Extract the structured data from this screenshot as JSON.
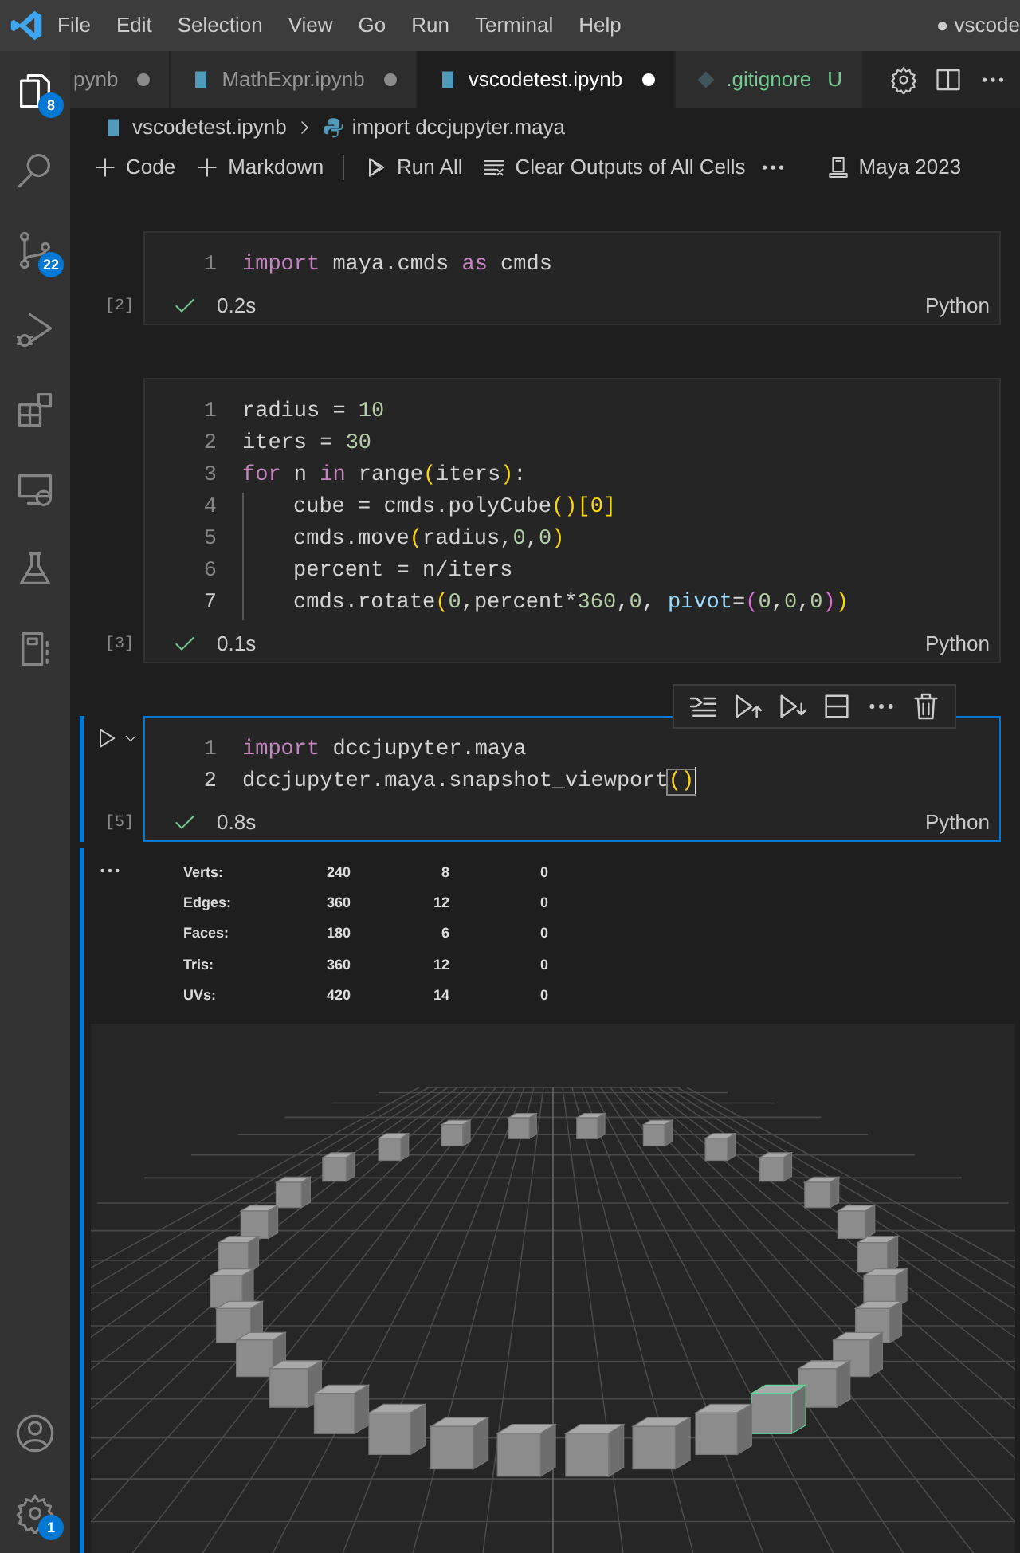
{
  "title_bar": {
    "menu": [
      "File",
      "Edit",
      "Selection",
      "View",
      "Go",
      "Run",
      "Terminal",
      "Help"
    ],
    "title": "● vscode"
  },
  "activity_bar": {
    "items": [
      {
        "kind": "files",
        "selected": true,
        "badge": "8"
      },
      {
        "kind": "search",
        "selected": false
      },
      {
        "kind": "source-control",
        "selected": false,
        "badge": "22"
      },
      {
        "kind": "debug",
        "selected": false
      },
      {
        "kind": "extensions",
        "selected": false
      },
      {
        "kind": "remote",
        "selected": false
      },
      {
        "kind": "testing",
        "selected": false
      },
      {
        "kind": "notebook",
        "selected": false
      }
    ],
    "bottom": [
      {
        "kind": "account"
      },
      {
        "kind": "settings",
        "badge": "1"
      }
    ]
  },
  "tabs": [
    {
      "label": "pynb",
      "selected": false,
      "modified": true,
      "untracked": false
    },
    {
      "label": "MathExpr.ipynb",
      "kind": "notebook",
      "selected": false,
      "modified": true,
      "untracked": false
    },
    {
      "label": "vscodetest.ipynb",
      "kind": "notebook",
      "selected": true,
      "modified": true,
      "untracked": false
    },
    {
      "label": ".gitignore",
      "kind": "git",
      "selected": false,
      "modified": false,
      "untracked": true,
      "status": "U"
    }
  ],
  "breadcrumb": [
    "vscodetest.ipynb",
    "import dccjupyter.maya"
  ],
  "toolbar": {
    "buttons": [
      {
        "kind": "plus",
        "label": "Code"
      },
      {
        "kind": "plus",
        "label": "Markdown"
      },
      {
        "kind": "run-all",
        "label": "Run All"
      },
      {
        "kind": "clear",
        "label": "Clear Outputs of All Cells"
      }
    ],
    "kernel": "Maya 2023"
  },
  "cells": [
    {
      "exec": "[2]",
      "time": "0.2s",
      "language": "Python",
      "focused": false,
      "lines": [
        {
          "n": "1",
          "current": false,
          "indented": false,
          "tokens": [
            {
              "kind": "kw",
              "text": "import"
            },
            {
              "kind": "id",
              "text": " maya.cmds "
            },
            {
              "kind": "kw",
              "text": "as"
            },
            {
              "kind": "id",
              "text": " cmds"
            }
          ]
        }
      ]
    },
    {
      "exec": "[3]",
      "time": "0.1s",
      "language": "Python",
      "focused": false,
      "lines": [
        {
          "n": "1",
          "current": false,
          "indented": false,
          "tokens": [
            {
              "kind": "id",
              "text": "radius = "
            },
            {
              "kind": "num",
              "text": "10"
            }
          ]
        },
        {
          "n": "2",
          "current": false,
          "indented": false,
          "tokens": [
            {
              "kind": "id",
              "text": "iters = "
            },
            {
              "kind": "num",
              "text": "30"
            }
          ]
        },
        {
          "n": "3",
          "current": false,
          "indented": false,
          "tokens": [
            {
              "kind": "kw",
              "text": "for"
            },
            {
              "kind": "id",
              "text": " n "
            },
            {
              "kind": "kw",
              "text": "in"
            },
            {
              "kind": "id",
              "text": " range"
            },
            {
              "kind": "br",
              "text": "("
            },
            {
              "kind": "id",
              "text": "iters"
            },
            {
              "kind": "br",
              "text": ")"
            },
            {
              "kind": "id",
              "text": ":"
            }
          ]
        },
        {
          "n": "4",
          "current": false,
          "indented": true,
          "tokens": [
            {
              "kind": "id",
              "text": "cube = cmds.polyCube"
            },
            {
              "kind": "br",
              "text": "()[0]"
            }
          ]
        },
        {
          "n": "5",
          "current": false,
          "indented": true,
          "tokens": [
            {
              "kind": "id",
              "text": "cmds.move"
            },
            {
              "kind": "br",
              "text": "("
            },
            {
              "kind": "id",
              "text": "radius,"
            },
            {
              "kind": "num",
              "text": "0"
            },
            {
              "kind": "id",
              "text": ","
            },
            {
              "kind": "num",
              "text": "0"
            },
            {
              "kind": "br",
              "text": ")"
            }
          ]
        },
        {
          "n": "6",
          "current": false,
          "indented": true,
          "tokens": [
            {
              "kind": "id",
              "text": "percent = n/iters"
            }
          ]
        },
        {
          "n": "7",
          "current": true,
          "indented": true,
          "tokens": [
            {
              "kind": "id",
              "text": "cmds.rotate"
            },
            {
              "kind": "br",
              "text": "("
            },
            {
              "kind": "num",
              "text": "0"
            },
            {
              "kind": "id",
              "text": ",percent*"
            },
            {
              "kind": "num",
              "text": "360"
            },
            {
              "kind": "id",
              "text": ","
            },
            {
              "kind": "num",
              "text": "0"
            },
            {
              "kind": "id",
              "text": ", "
            },
            {
              "kind": "param",
              "text": "pivot"
            },
            {
              "kind": "id",
              "text": "="
            },
            {
              "kind": "br2",
              "text": "("
            },
            {
              "kind": "num",
              "text": "0"
            },
            {
              "kind": "id",
              "text": ","
            },
            {
              "kind": "num",
              "text": "0"
            },
            {
              "kind": "id",
              "text": ","
            },
            {
              "kind": "num",
              "text": "0"
            },
            {
              "kind": "br2",
              "text": ")"
            },
            {
              "kind": "br",
              "text": ")"
            }
          ]
        }
      ]
    },
    {
      "exec": "[5]",
      "time": "0.8s",
      "language": "Python",
      "focused": true,
      "lines": [
        {
          "n": "1",
          "current": false,
          "indented": false,
          "tokens": [
            {
              "kind": "kw",
              "text": "import"
            },
            {
              "kind": "id",
              "text": " dccjupyter.maya"
            }
          ]
        },
        {
          "n": "2",
          "current": true,
          "indented": false,
          "tokens": [
            {
              "kind": "id",
              "text": "dccjupyter.maya.snapshot_viewport"
            },
            {
              "kind": "match",
              "text": "()"
            }
          ]
        }
      ],
      "output": {
        "stats": [
          [
            "Verts:",
            "240",
            "8",
            "0"
          ],
          [
            "Edges:",
            "360",
            "12",
            "0"
          ],
          [
            "Faces:",
            "180",
            "6",
            "0"
          ],
          [
            "Tris:",
            "360",
            "12",
            "0"
          ],
          [
            "UVs:",
            "420",
            "14",
            "0"
          ]
        ]
      }
    }
  ]
}
